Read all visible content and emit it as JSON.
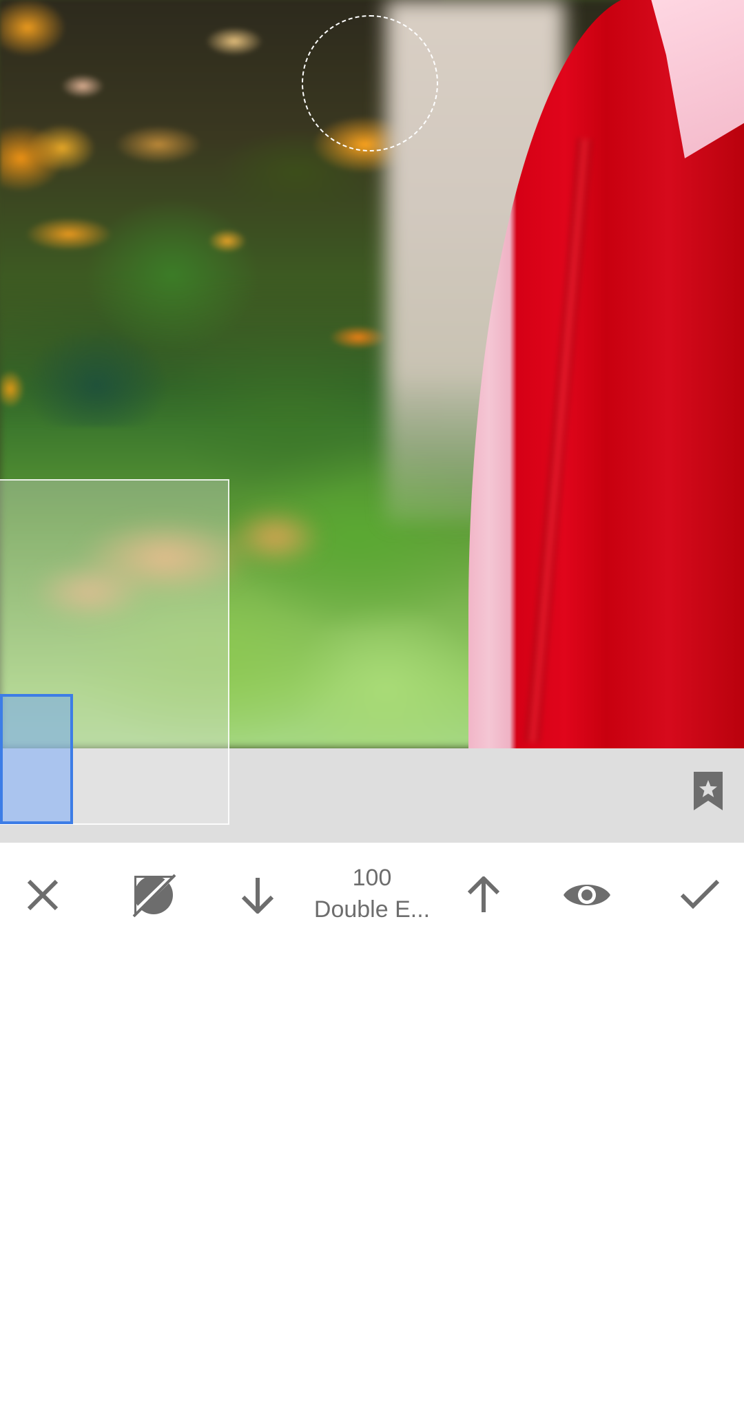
{
  "editor": {
    "tool_value": "100",
    "tool_name": "Double E..."
  },
  "toolbar": {
    "cancel_icon": "close-icon",
    "mask_icon": "mask-toggle-icon",
    "decrease_icon": "arrow-down-icon",
    "increase_icon": "arrow-up-icon",
    "preview_icon": "eye-icon",
    "apply_icon": "check-icon"
  },
  "bookmark": {
    "icon": "bookmark-star-icon"
  },
  "colors": {
    "icon_gray": "#6d6d6d",
    "strip_gray": "#dedede",
    "loupe_blue": "#3d7de6"
  }
}
